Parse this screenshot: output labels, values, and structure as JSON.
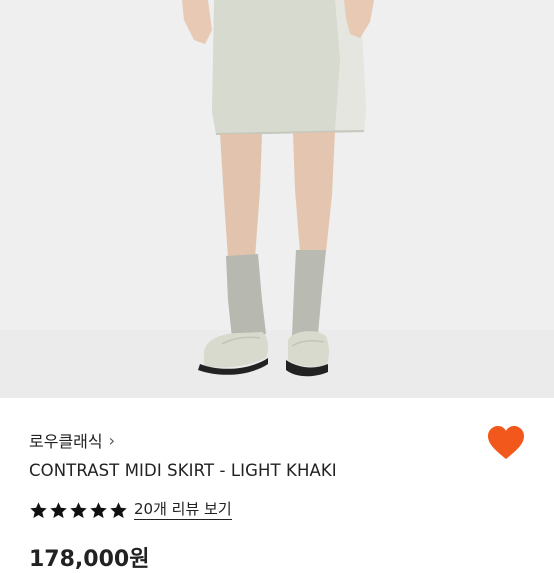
{
  "product": {
    "brand": "로우클래식",
    "brand_chevron": "›",
    "title": "CONTRAST MIDI SKIRT - LIGHT KHAKI",
    "rating_stars": 5,
    "review_link": "20개 리뷰 보기",
    "price": "178,000원",
    "wishlist_icon": "heart-icon",
    "star_icon": "star-icon"
  },
  "colors": {
    "heart": "#f2571b",
    "star": "#111111",
    "background": "#efefef",
    "skirt": "#d7dace"
  }
}
